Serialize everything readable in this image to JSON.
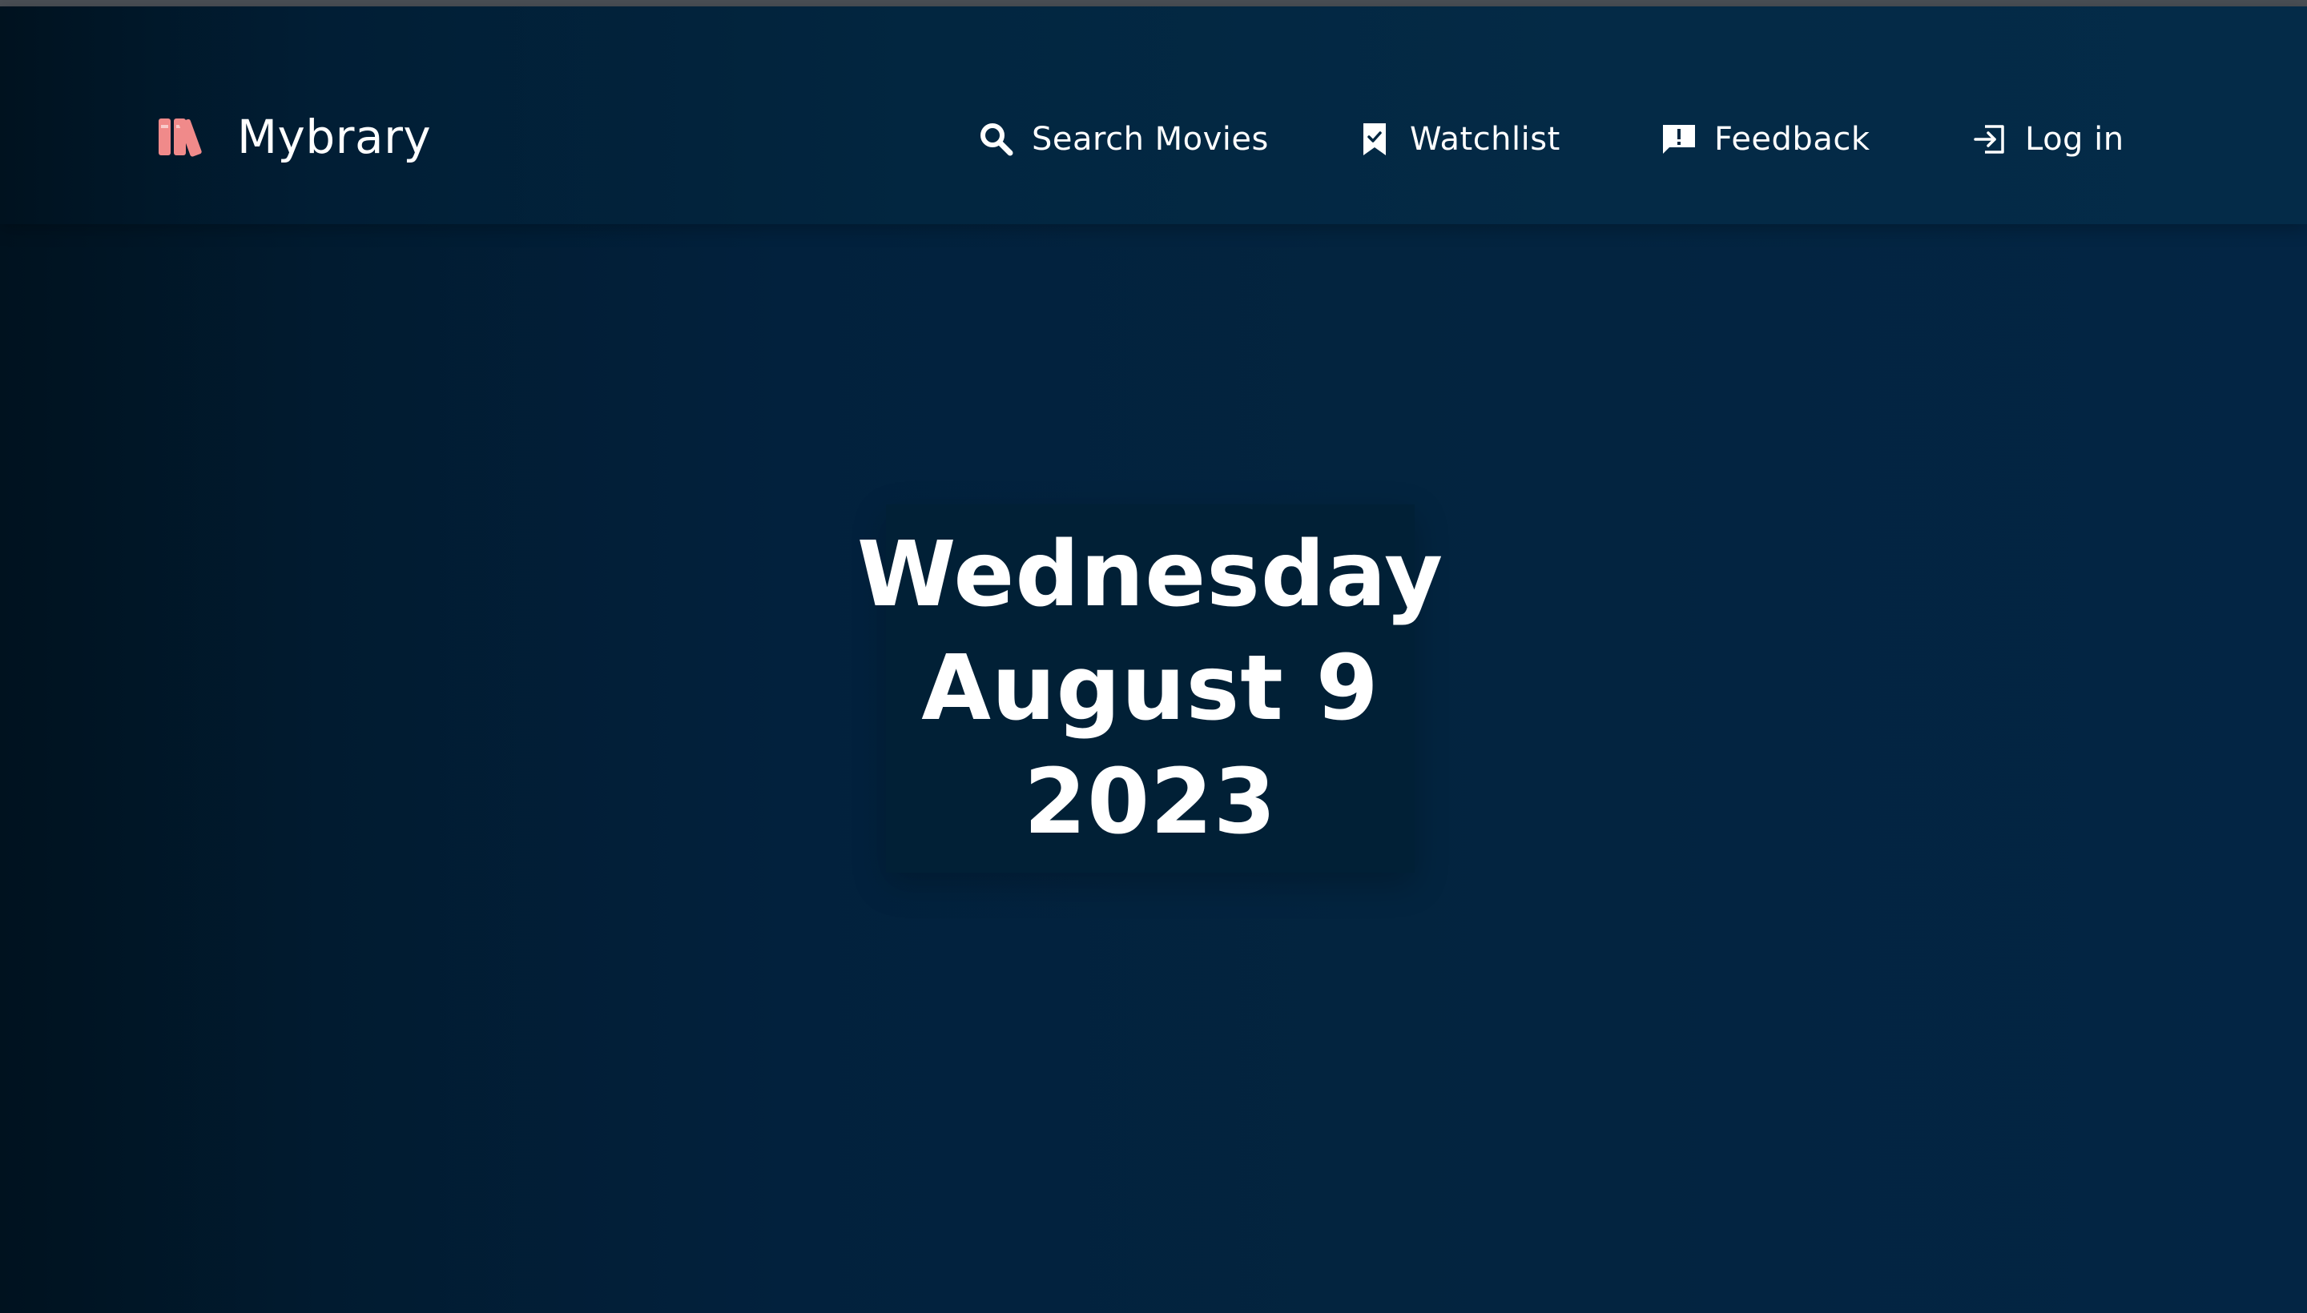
{
  "app": {
    "name": "Mybrary",
    "brand_color": "#f08a8a",
    "logo_icon": "books-icon"
  },
  "nav": {
    "items": [
      {
        "label": "Search Movies",
        "icon": "search-icon"
      },
      {
        "label": "Watchlist",
        "icon": "bookmark-check-icon"
      },
      {
        "label": "Feedback",
        "icon": "feedback-icon"
      },
      {
        "label": "Log in",
        "icon": "login-icon"
      }
    ]
  },
  "hero": {
    "weekday": "Wednesday",
    "month_day": "August 9",
    "year": "2023"
  },
  "colors": {
    "background_dark": "#00121f",
    "background_mid": "#02213d",
    "text": "#ffffff"
  }
}
